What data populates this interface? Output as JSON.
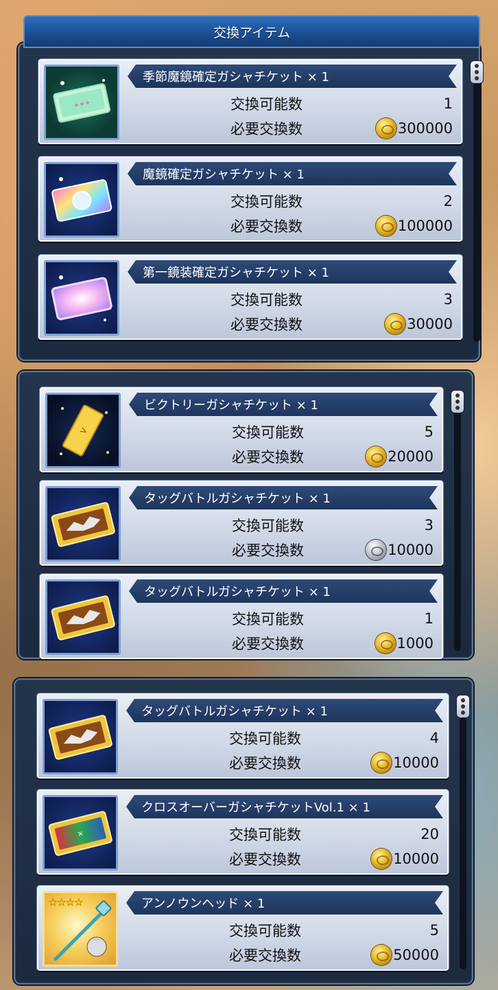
{
  "header": {
    "title": "交換アイテム"
  },
  "labels": {
    "available": "交換可能数",
    "required": "必要交換数"
  },
  "sections": [
    {
      "items": [
        {
          "name": "季節魔鏡確定ガシャチケット × 1",
          "available": "1",
          "cost": "300000",
          "currency": "gold-coin-icon",
          "icon": "seasonal-ticket-icon"
        },
        {
          "name": "魔鏡確定ガシャチケット × 1",
          "available": "2",
          "cost": "100000",
          "currency": "gold-coin-icon",
          "icon": "rainbow-ticket-icon"
        },
        {
          "name": "第一鏡装確定ガシャチケット × 1",
          "available": "3",
          "cost": "30000",
          "currency": "gold-coin-icon",
          "icon": "pink-ticket-icon"
        }
      ]
    },
    {
      "items": [
        {
          "name": "ビクトリーガシャチケット × 1",
          "available": "5",
          "cost": "20000",
          "currency": "gold-coin-icon",
          "icon": "victory-ticket-icon"
        },
        {
          "name": "タッグバトルガシャチケット × 1",
          "available": "3",
          "cost": "10000",
          "currency": "silver-coin-icon",
          "icon": "tag-battle-ticket-icon"
        },
        {
          "name": "タッグバトルガシャチケット × 1",
          "available": "1",
          "cost": "1000",
          "currency": "gold-coin-icon",
          "icon": "tag-battle-ticket-icon"
        }
      ]
    },
    {
      "items": [
        {
          "name": "タッグバトルガシャチケット × 1",
          "available": "4",
          "cost": "10000",
          "currency": "gold-coin-icon",
          "icon": "tag-battle-ticket-icon"
        },
        {
          "name": "クロスオーバーガシャチケットVol.1 × 1",
          "available": "20",
          "cost": "10000",
          "currency": "gold-coin-icon",
          "icon": "crossover-ticket-icon"
        },
        {
          "name": "アンノウンヘッド × 1",
          "available": "5",
          "cost": "50000",
          "currency": "gold-coin-icon",
          "icon": "unknown-head-weapon-icon"
        }
      ]
    }
  ],
  "colors": {
    "panel": "#1c2a3f",
    "header": "#1c4f93",
    "card": "#cfd8e6",
    "title_bar": "#1e355c"
  }
}
